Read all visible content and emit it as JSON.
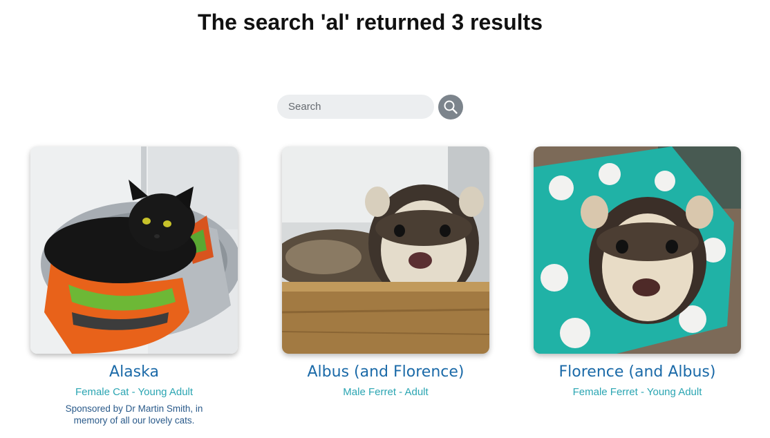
{
  "heading": "The search 'al' returned 3 results",
  "search": {
    "placeholder": "Search",
    "value": "",
    "button_icon": "search-icon"
  },
  "colors": {
    "name": "#1b6aa8",
    "subtitle": "#2aa5b2",
    "note": "#2a5a8a",
    "search_button": "#7c848c"
  },
  "results": [
    {
      "name": "Alaska",
      "subtitle": "Female Cat - Young Adult",
      "note": "Sponsored by Dr Martin Smith, in memory of all our lovely cats."
    },
    {
      "name": "Albus (and Florence)",
      "subtitle": "Male Ferret - Adult",
      "note": ""
    },
    {
      "name": "Florence (and Albus)",
      "subtitle": "Female Ferret - Young Adult",
      "note": ""
    }
  ]
}
